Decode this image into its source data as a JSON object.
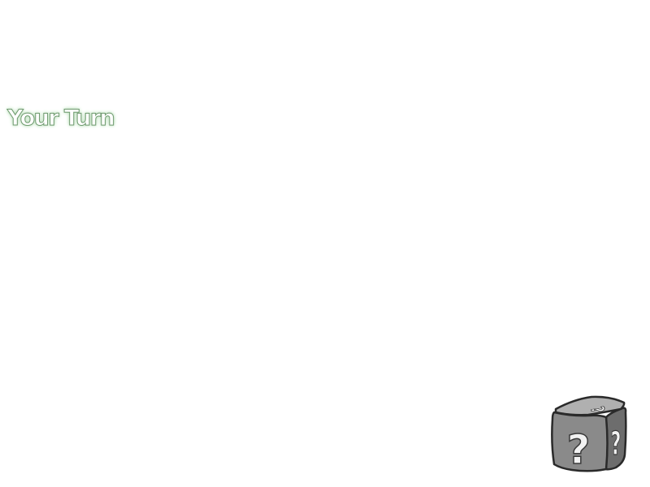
{
  "game": {
    "turn_indicator": "Your Turn"
  },
  "dice": {
    "face_symbol": "?",
    "icon": "mystery-dice-icon"
  },
  "colors": {
    "background": "#ffffff",
    "turn_text_outline": "#6f9a6f",
    "turn_text_glow": "#c9e8c9",
    "dice_front": "#8a8a8a",
    "dice_top": "#b0b0b0",
    "dice_side": "#6d6d6d"
  }
}
